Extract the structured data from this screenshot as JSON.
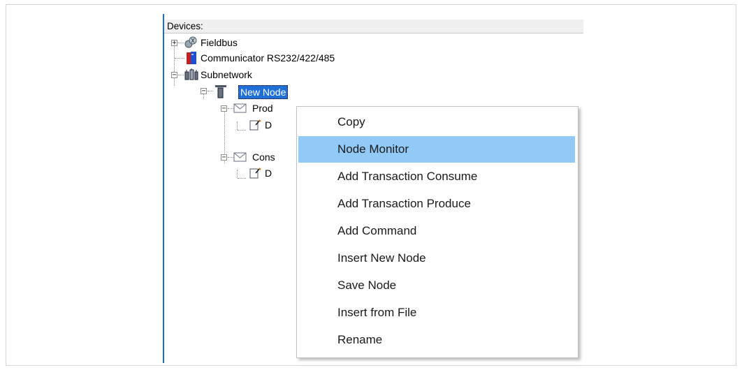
{
  "panel": {
    "header": "Devices:"
  },
  "tree": {
    "fieldbus": "Fieldbus",
    "communicator": "Communicator RS232/422/485",
    "subnetwork": "Subnetwork",
    "new_node": "New Node",
    "produce": "Prod",
    "produce_child": "D",
    "consume": "Cons",
    "consume_child": "D"
  },
  "context_menu": {
    "items": [
      {
        "label": "Copy"
      },
      {
        "label": "Node Monitor",
        "highlighted": true
      },
      {
        "label": "Add Transaction Consume"
      },
      {
        "label": "Add Transaction Produce"
      },
      {
        "label": "Add Command"
      },
      {
        "label": "Insert New Node"
      },
      {
        "label": "Save Node"
      },
      {
        "label": "Insert from File"
      },
      {
        "label": "Rename"
      }
    ]
  },
  "colors": {
    "selection": "#1e6fd6",
    "menu_highlight": "#91c9f7",
    "panel_border": "#1e6fc2"
  }
}
